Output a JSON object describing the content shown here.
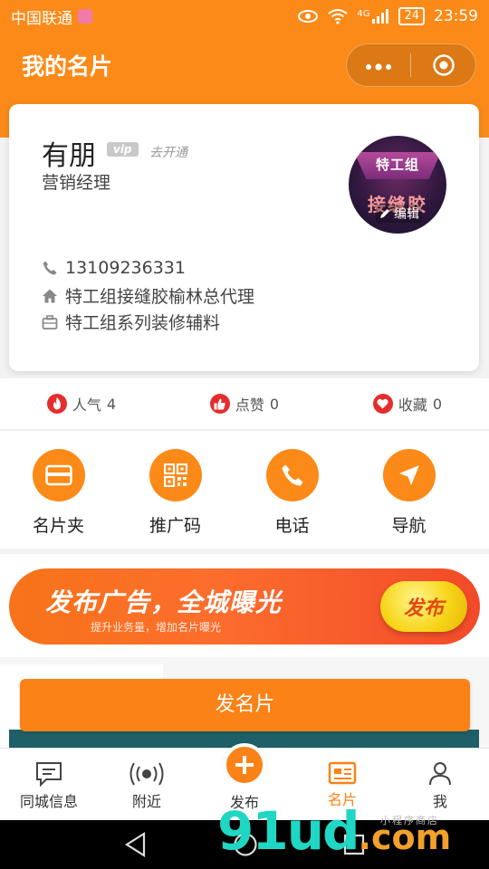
{
  "status_bar": {
    "carrier": "中国联通",
    "network": "4G",
    "battery": "24",
    "time": "23:59"
  },
  "header": {
    "title": "我的名片"
  },
  "card": {
    "name": "有朋",
    "vip_badge": "vip",
    "vip_open": "去开通",
    "position": "营销经理",
    "avatar_text_top": "特工组",
    "avatar_text_bottom": "接缝胶",
    "edit_label": "编辑",
    "phone": "13109236331",
    "company": "特工组接缝胶榆林总代理",
    "business": "特工组系列装修辅料"
  },
  "stats": [
    {
      "label": "人气",
      "value": "4"
    },
    {
      "label": "点赞",
      "value": "0"
    },
    {
      "label": "收藏",
      "value": "0"
    }
  ],
  "actions": [
    {
      "label": "名片夹",
      "icon": "card-holder-icon"
    },
    {
      "label": "推广码",
      "icon": "qr-code-icon"
    },
    {
      "label": "电话",
      "icon": "phone-icon"
    },
    {
      "label": "导航",
      "icon": "navigation-icon"
    }
  ],
  "banner": {
    "title": "发布广告，全城曝光",
    "subtitle": "提升业务量，增加名片曝光",
    "button": "发布"
  },
  "post_card_button": "发名片",
  "tabbar": [
    {
      "label": "同城信息",
      "icon": "message-icon"
    },
    {
      "label": "附近",
      "icon": "broadcast-icon"
    },
    {
      "label": "发布",
      "icon": "plus-icon"
    },
    {
      "label": "名片",
      "icon": "card-icon",
      "active": true
    },
    {
      "label": "我",
      "icon": "user-icon"
    }
  ],
  "watermark": {
    "main": "91ud",
    "suffix": ".com",
    "small": "小程序商店"
  },
  "colors": {
    "brand_orange": "#fb8a18",
    "heart_red": "#e52d2d",
    "banner_yellow": "#f7d518"
  }
}
